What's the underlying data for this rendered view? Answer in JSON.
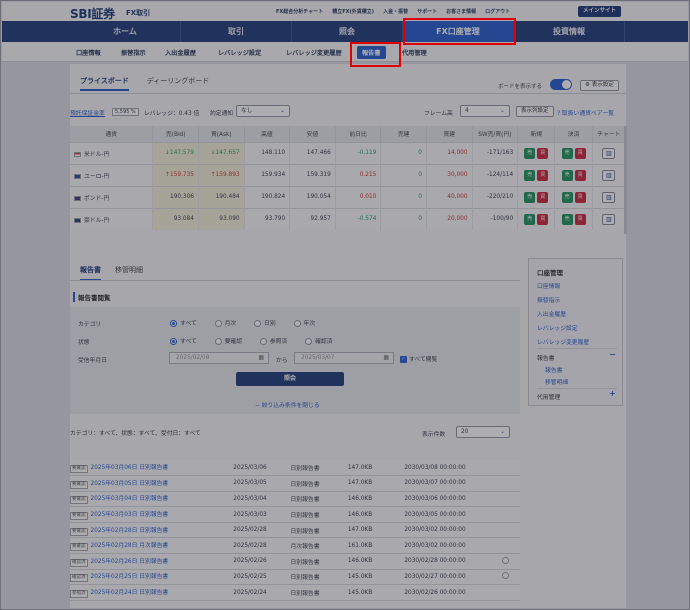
{
  "header": {
    "logo": "SBI証券",
    "logo_sub": "FX取引",
    "links": [
      "FX総合分析チャート",
      "積立FX(外貨積立)",
      "入金・振替",
      "サポート",
      "お客さま情報",
      "ログアウト"
    ],
    "mypage": "メインサイト"
  },
  "mainnav": {
    "items": [
      "ホーム",
      "取引",
      "照会",
      "FX口座管理",
      "投資情報"
    ],
    "active": "FX口座管理"
  },
  "subnav": {
    "items": [
      "口座情報",
      "振替指示",
      "入出金履歴",
      "レバレッジ設定",
      "レバレッジ変更履歴",
      "報告書",
      "代用管理"
    ],
    "current": "報告書"
  },
  "board": {
    "tabs": [
      "プライスボード",
      "ディーリングボード"
    ],
    "show_board_label": "ボードを表示する",
    "settings_btn": "表示設定",
    "margin_rate_label": "預託保証金率",
    "margin_rate_value": "5,595 %",
    "leverage_label": "レバレッジ：0.43 倍",
    "order_notify_label": "約定通知",
    "order_notify_value": "なし",
    "frame_label": "フレーム高",
    "frame_value": "4",
    "list_settings_btn": "表示列設定",
    "pairs_link": "取扱い通貨ペア一覧"
  },
  "rates": {
    "headers": [
      "通貨",
      "売(Bid)",
      "買(Ask)",
      "高値",
      "安値",
      "前日比",
      "売建",
      "買建",
      "SW売/買(円)",
      "新規",
      "決済",
      "チャート"
    ],
    "rows": [
      {
        "pair": "米ドル-円",
        "bid": "147.579",
        "ask": "147.657",
        "high": "148.110",
        "low": "147.466",
        "chg": "-0.119",
        "sell": "0",
        "buy": "14,000",
        "sw": "-171/163",
        "dir": "dn"
      },
      {
        "pair": "ユーロ-円",
        "bid": "159.735",
        "ask": "159.893",
        "high": "159.934",
        "low": "159.319",
        "chg": "0.215",
        "sell": "0",
        "buy": "30,000",
        "sw": "-124/114",
        "dir": "up"
      },
      {
        "pair": "ポンド-円",
        "bid": "190.306",
        "ask": "190.484",
        "high": "190.824",
        "low": "190.054",
        "chg": "0.010",
        "sell": "0",
        "buy": "40,000",
        "sw": "-220/210",
        "dir": ""
      },
      {
        "pair": "豪ドル-円",
        "bid": "93.084",
        "ask": "93.090",
        "high": "93.790",
        "low": "92.957",
        "chg": "-0.574",
        "sell": "0",
        "buy": "20,000",
        "sw": "-100/90",
        "dir": ""
      }
    ],
    "sell_btn": "売",
    "buy_btn": "買"
  },
  "reports": {
    "tabs": [
      "報告書",
      "移管明細"
    ],
    "section_title": "報告書閲覧",
    "category_label": "カテゴリ",
    "category_options": [
      "すべて",
      "月次",
      "日別",
      "年次"
    ],
    "status_label": "状態",
    "status_options": [
      "すべて",
      "要確認",
      "参照済",
      "確認済"
    ],
    "date_label": "受信年月日",
    "date_from": "2025/02/08",
    "date_to": "2025/03/07",
    "date_sep": "から",
    "all_browse": "すべて閲覧",
    "search_btn": "照会",
    "close_filter": "絞り込み条件を閉じる",
    "conditions": "カテゴリ：すべて、状態：すべて、受付日：すべて",
    "count_label": "表示件数",
    "count_value": "20",
    "rows": [
      {
        "badge": "要確認",
        "title": "2025年03月06日 日別報告書",
        "date": "2025/03/06",
        "type": "日別報告書",
        "size": "147.0KB",
        "recv": "2030/03/08 00:00:00"
      },
      {
        "badge": "要確認",
        "title": "2025年03月05日 日別報告書",
        "date": "2025/03/05",
        "type": "日別報告書",
        "size": "147.0KB",
        "recv": "2030/03/07 00:00:00"
      },
      {
        "badge": "要確認",
        "title": "2025年03月04日 日別報告書",
        "date": "2025/03/04",
        "type": "日別報告書",
        "size": "146.0KB",
        "recv": "2030/03/06 00:00:00"
      },
      {
        "badge": "要確認",
        "title": "2025年03月03日 日別報告書",
        "date": "2025/03/03",
        "type": "日別報告書",
        "size": "146.0KB",
        "recv": "2030/03/05 00:00:00"
      },
      {
        "badge": "要確認",
        "title": "2025年02月28日 日別報告書",
        "date": "2025/02/28",
        "type": "日別報告書",
        "size": "147.0KB",
        "recv": "2030/03/02 00:00:00"
      },
      {
        "badge": "要確認",
        "title": "2025年02月28日 月次報告書",
        "date": "2025/02/28",
        "type": "月次報告書",
        "size": "161.0KB",
        "recv": "2030/03/02 00:00:00"
      },
      {
        "badge": "確認済",
        "title": "2025年02月26日 日別報告書",
        "date": "2025/02/26",
        "type": "日別報告書",
        "size": "146.0KB",
        "recv": "2030/02/28 00:00:00"
      },
      {
        "badge": "確認済",
        "title": "2025年02月25日 日別報告書",
        "date": "2025/02/25",
        "type": "日別報告書",
        "size": "145.0KB",
        "recv": "2030/02/27 00:00:00"
      },
      {
        "badge": "参照済",
        "title": "2025年02月24日 日別報告書",
        "date": "2025/02/24",
        "type": "日別報告書",
        "size": "145.0KB",
        "recv": "2030/02/26 00:00:00"
      }
    ]
  },
  "sidemenu": {
    "title": "口座管理",
    "items": [
      "口座情報",
      "振替指示",
      "入出金履歴",
      "レバレッジ設定",
      "レバレッジ変更履歴"
    ],
    "report_group": "報告書",
    "report_children": [
      "報告書",
      "移管明細"
    ],
    "substitute": "代用管理"
  }
}
